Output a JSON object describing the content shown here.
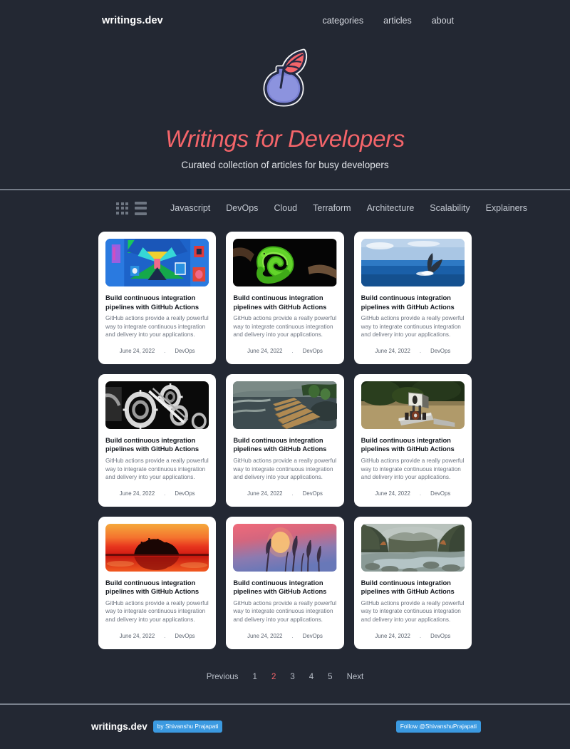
{
  "header": {
    "brand": "writings.dev",
    "nav": [
      {
        "label": "categories"
      },
      {
        "label": "articles"
      },
      {
        "label": "about"
      }
    ]
  },
  "hero": {
    "logo_icon": "quill-inkwell-icon",
    "title": "Writings for Developers",
    "subtitle": "Curated collection of articles for busy developers",
    "title_color": "#f4656a"
  },
  "filterbar": {
    "view_grid_icon": "grid-view-icon",
    "view_list_icon": "list-view-icon",
    "categories": [
      {
        "label": "Javascript"
      },
      {
        "label": "DevOps"
      },
      {
        "label": "Cloud"
      },
      {
        "label": "Terraform"
      },
      {
        "label": "Architecture"
      },
      {
        "label": "Scalability"
      },
      {
        "label": "Explainers"
      }
    ]
  },
  "cards": [
    {
      "title": "Build continuous integration pipelines with GitHub Actions",
      "desc": "GitHub actions provide a really powerful way to integrate continuous integration and delivery into your applications.",
      "date": "June 24, 2022",
      "separator": ".",
      "category": "DevOps",
      "image": "abstract-blue-pixel-art"
    },
    {
      "title": "Build continuous integration pipelines with GitHub Actions",
      "desc": "GitHub actions provide a really powerful way to integrate continuous integration and delivery into your applications.",
      "date": "June 24, 2022",
      "separator": ".",
      "category": "DevOps",
      "image": "green-tree-python-on-branch"
    },
    {
      "title": "Build continuous integration pipelines with GitHub Actions",
      "desc": "GitHub actions provide a really powerful way to integrate continuous integration and delivery into your applications.",
      "date": "June 24, 2022",
      "separator": ".",
      "category": "DevOps",
      "image": "whale-tail-in-ocean"
    },
    {
      "title": "Build continuous integration pipelines with GitHub Actions",
      "desc": "GitHub actions provide a really powerful way to integrate continuous integration and delivery into your applications.",
      "date": "June 24, 2022",
      "separator": ".",
      "category": "DevOps",
      "image": "black-white-gears"
    },
    {
      "title": "Build continuous integration pipelines with GitHub Actions",
      "desc": "GitHub actions provide a really powerful way to integrate continuous integration and delivery into your applications.",
      "date": "June 24, 2022",
      "separator": ".",
      "category": "DevOps",
      "image": "wooden-boardwalk-over-water"
    },
    {
      "title": "Build continuous integration pipelines with GitHub Actions",
      "desc": "GitHub actions provide a really powerful way to integrate continuous integration and delivery into your applications.",
      "date": "June 24, 2022",
      "separator": ".",
      "category": "DevOps",
      "image": "metal-robot-sculpture"
    },
    {
      "title": "Build continuous integration pipelines with GitHub Actions",
      "desc": "GitHub actions provide a really powerful way to integrate continuous integration and delivery into your applications.",
      "date": "June 24, 2022",
      "separator": ".",
      "category": "DevOps",
      "image": "orange-sunset-lake-island"
    },
    {
      "title": "Build continuous integration pipelines with GitHub Actions",
      "desc": "GitHub actions provide a really powerful way to integrate continuous integration and delivery into your applications.",
      "date": "June 24, 2022",
      "separator": ".",
      "category": "DevOps",
      "image": "purple-sunset-with-grass"
    },
    {
      "title": "Build continuous integration pipelines with GitHub Actions",
      "desc": "GitHub actions provide a really powerful way to integrate continuous integration and delivery into your applications.",
      "date": "June 24, 2022",
      "separator": ".",
      "category": "DevOps",
      "image": "misty-forest-river"
    }
  ],
  "pagination": {
    "previous": "Previous",
    "pages": [
      {
        "label": "1",
        "active": false
      },
      {
        "label": "2",
        "active": true
      },
      {
        "label": "3",
        "active": false
      },
      {
        "label": "4",
        "active": false
      },
      {
        "label": "5",
        "active": false
      }
    ],
    "next": "Next",
    "active_color": "#f4656a"
  },
  "footer": {
    "brand": "writings.dev",
    "author_badge": "by Shivanshu Prajapati",
    "follow_badge": "Follow @ShivanshuPrajapati",
    "badge_color": "#3b9ae1"
  }
}
